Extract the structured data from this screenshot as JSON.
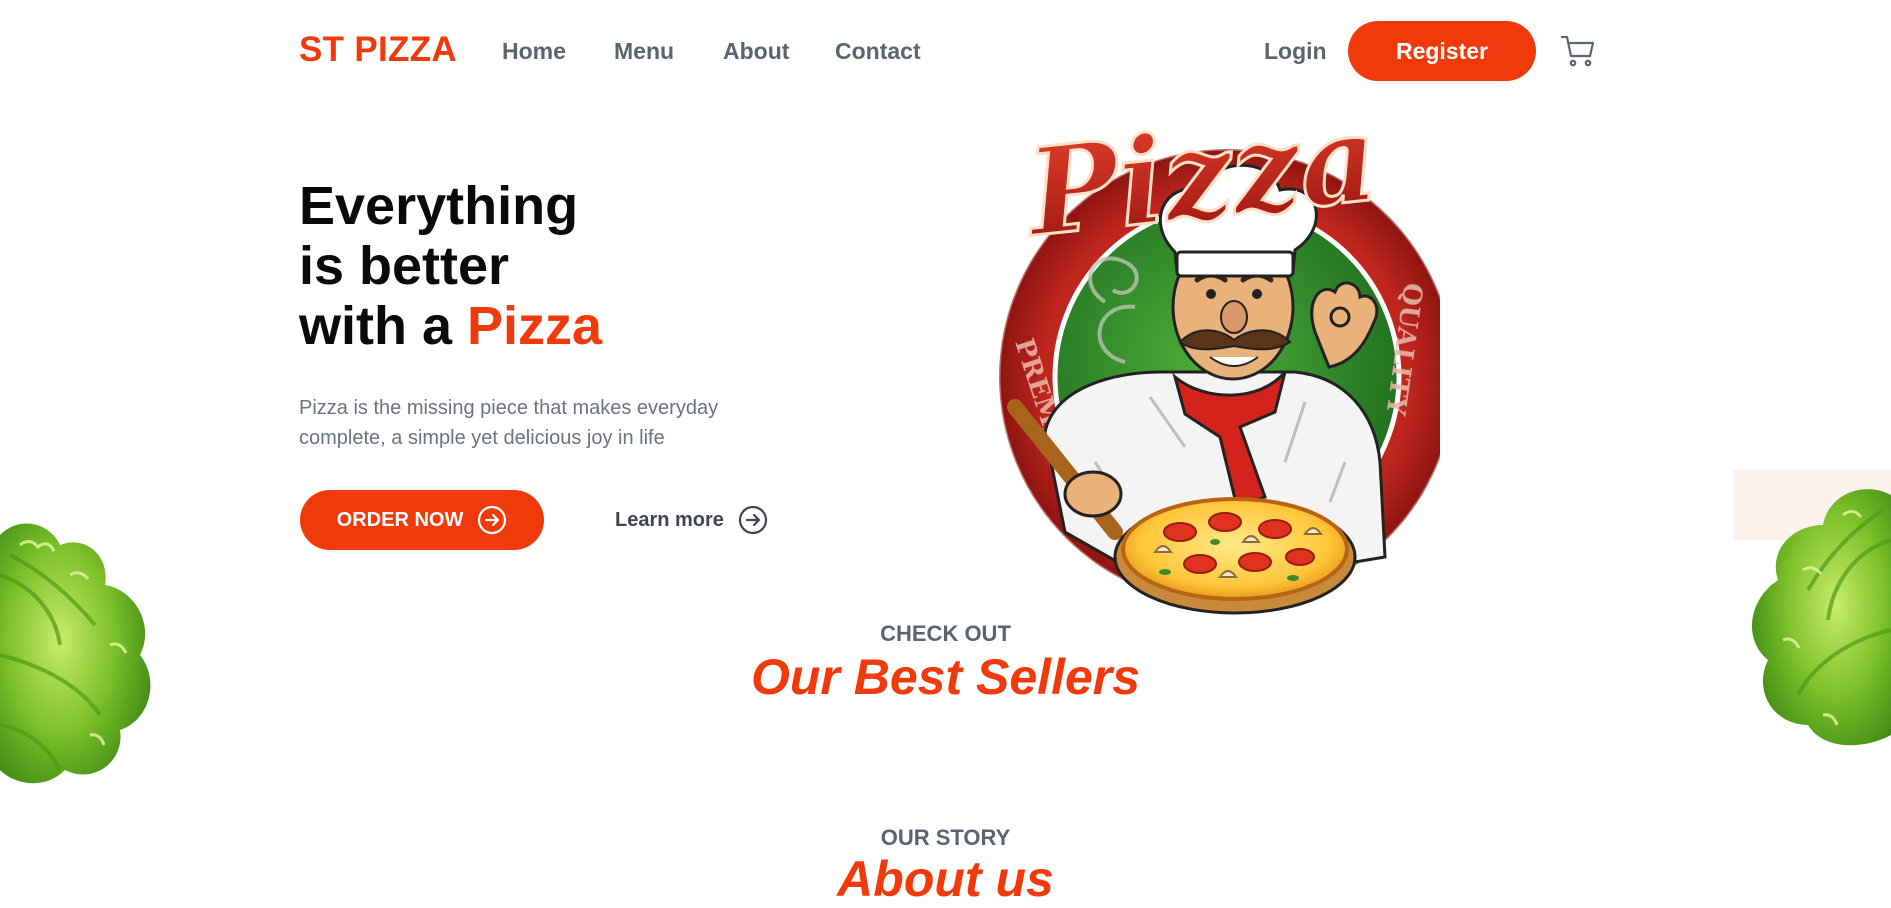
{
  "header": {
    "logo": "ST PIZZA",
    "nav": [
      "Home",
      "Menu",
      "About",
      "Contact"
    ],
    "login": "Login",
    "register": "Register",
    "cart_icon": "cart-icon"
  },
  "hero": {
    "title_line1": "Everything",
    "title_line2": "is better",
    "title_line3_prefix": "with a ",
    "title_line3_accent": "Pizza",
    "subtitle": "Pizza is the missing piece that makes everyday complete, a simple yet delicious joy in life",
    "order_button": "ORDER NOW",
    "learn_more": "Learn more",
    "art": {
      "script_word": "Pizza",
      "ring_left": "PREMIUM",
      "ring_right": "QUALITY"
    }
  },
  "best_sellers": {
    "eyebrow": "CHECK OUT",
    "title": "Our Best Sellers"
  },
  "about": {
    "eyebrow": "OUR STORY",
    "title": "About us"
  },
  "colors": {
    "accent": "#f13a0c",
    "nav_text": "#5c6470",
    "heading": "#0a0a0a",
    "muted": "#6b7280"
  }
}
